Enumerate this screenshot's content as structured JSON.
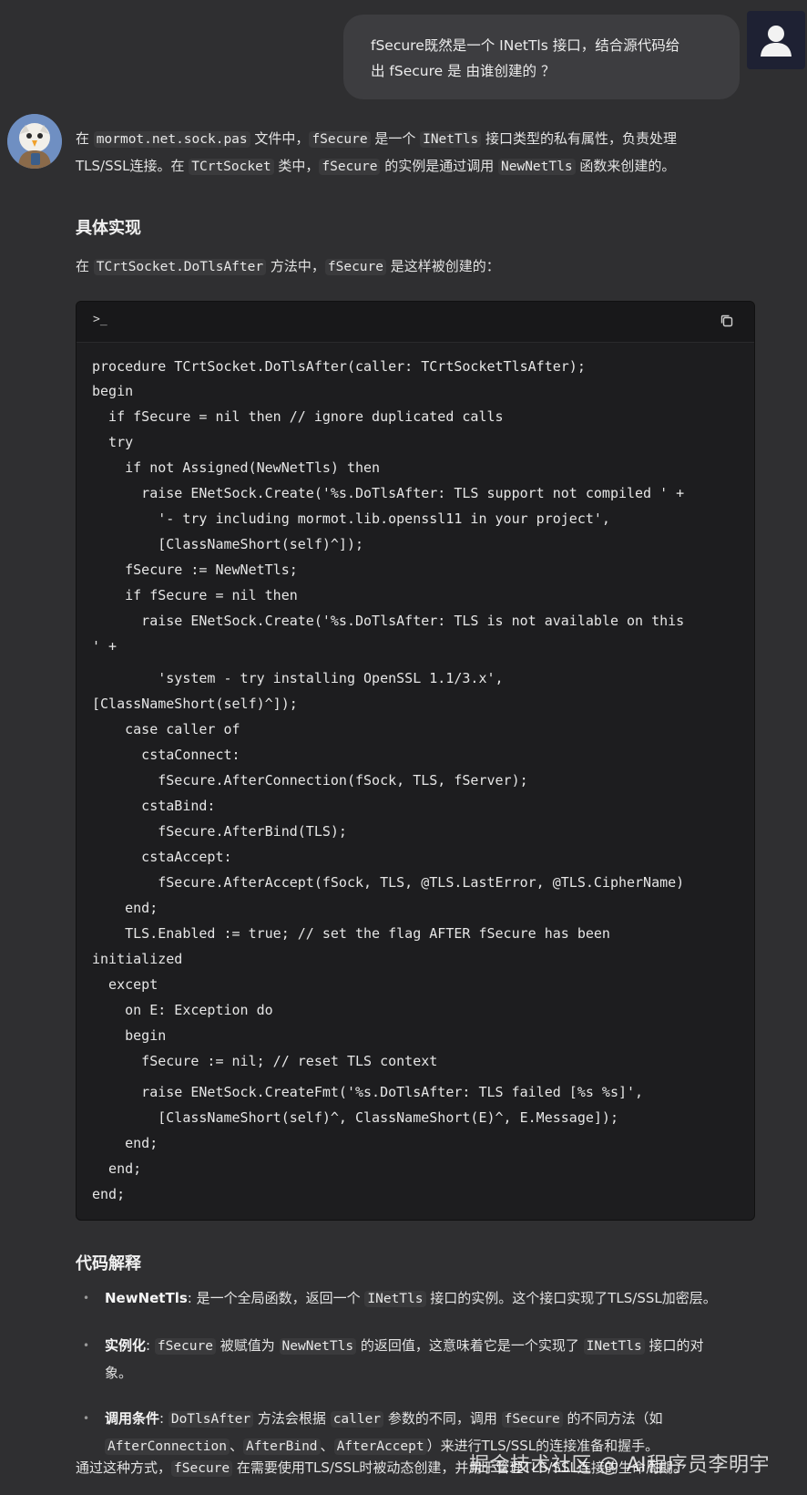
{
  "user_message": {
    "line1": "fSecure既然是一个 INetTls 接口，结合源代码给",
    "line2": "出 fSecure 是 由谁创建的 ？"
  },
  "answer": {
    "intro_1": {
      "a": "在 ",
      "b": "mormot.net.sock.pas",
      "c": " 文件中，",
      "d": "fSecure",
      "e": " 是一个 ",
      "f": "INetTls",
      "g": " 接口类型的私有属性，负责处理"
    },
    "intro_2": {
      "a": "TLS/SSL连接。在 ",
      "b": "TCrtSocket",
      "c": " 类中，",
      "d": "fSecure",
      "e": " 的实例是通过调用 ",
      "f": "NewNetTls",
      "g": " 函数来创建的。"
    },
    "heading_impl": "具体实现",
    "impl_line": {
      "a": "在 ",
      "b": "TCrtSocket.DoTlsAfter",
      "c": " 方法中，",
      "d": "fSecure",
      "e": " 是这样被创建的："
    },
    "code_header_icon": ">_",
    "code_lines": [
      "procedure TCrtSocket.DoTlsAfter(caller: TCrtSocketTlsAfter);",
      "begin",
      "  if fSecure = nil then // ignore duplicated calls",
      "  try",
      "    if not Assigned(NewNetTls) then",
      "      raise ENetSock.Create('%s.DoTlsAfter: TLS support not compiled ' +",
      "        '- try including mormot.lib.openssl11 in your project',",
      "        [ClassNameShort(self)^]);",
      "    fSecure := NewNetTls;",
      "    if fSecure = nil then",
      "      raise ENetSock.Create('%s.DoTlsAfter: TLS is not available on this",
      "' +",
      "        'system - try installing OpenSSL 1.1/3.x',",
      "[ClassNameShort(self)^]);",
      "    case caller of",
      "      cstaConnect:",
      "        fSecure.AfterConnection(fSock, TLS, fServer);",
      "      cstaBind:",
      "        fSecure.AfterBind(TLS);",
      "      cstaAccept:",
      "        fSecure.AfterAccept(fSock, TLS, @TLS.LastError, @TLS.CipherName)",
      "    end;",
      "    TLS.Enabled := true; // set the flag AFTER fSecure has been",
      "initialized",
      "  except",
      "    on E: Exception do",
      "    begin",
      "      fSecure := nil; // reset TLS context",
      "      raise ENetSock.CreateFmt('%s.DoTlsAfter: TLS failed [%s %s]',",
      "        [ClassNameShort(self)^, ClassNameShort(E)^, E.Message]);",
      "    end;",
      "  end;",
      "end;"
    ],
    "heading_explain": "代码解释",
    "bullet1": {
      "label": "NewNetTls",
      "a": ": 是一个全局函数，返回一个 ",
      "b": "INetTls",
      "c": " 接口的实例。这个接口实现了TLS/SSL加密层。"
    },
    "bullet2": {
      "label": "实例化",
      "a": ": ",
      "b": "fSecure",
      "c": " 被赋值为 ",
      "d": "NewNetTls",
      "e": " 的返回值，这意味着它是一个实现了 ",
      "f": "INetTls",
      "g": " 接口的对",
      "h": "象。"
    },
    "bullet3": {
      "label": "调用条件",
      "a": ": ",
      "b": "DoTlsAfter",
      "c": " 方法会根据 ",
      "d": "caller",
      "e": " 参数的不同，调用 ",
      "f": "fSecure",
      "g": " 的不同方法（如",
      "h": "AfterConnection",
      "i": "、",
      "j": "AfterBind",
      "k": "、",
      "l": "AfterAccept",
      "m": "）来进行TLS/SSL的连接准备和握手。"
    },
    "closing": {
      "a": "通过这种方式，",
      "b": "fSecure",
      "c": " 在需要使用TLS/SSL时被动态创建，并用于管理TLS/SSL连接的生命周期。"
    }
  },
  "watermark": "掘金技术社区 @ AI程序员李明宇",
  "icons": {
    "user": "user-avatar-icon",
    "bot": "eagle-avatar-icon",
    "copy": "copy-icon",
    "terminal": "terminal-icon"
  }
}
